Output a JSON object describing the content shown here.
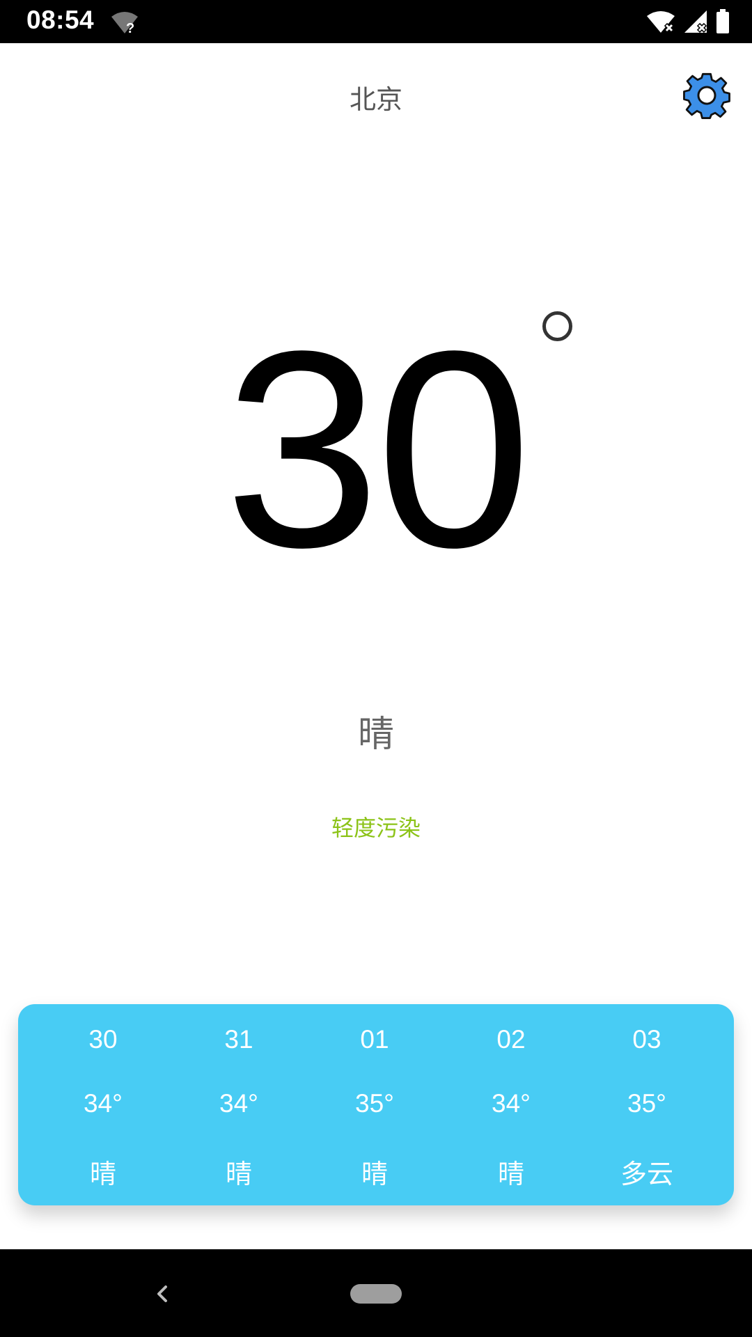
{
  "status_bar": {
    "time": "08:54",
    "icons": [
      "wifi-unknown-icon",
      "wifi-off-icon",
      "signal-off-icon",
      "battery-icon"
    ]
  },
  "header": {
    "city": "北京",
    "settings_icon": "gear-icon"
  },
  "current": {
    "temperature": "30",
    "weather": "晴",
    "air_quality": "轻度污染"
  },
  "forecast": [
    {
      "date": "30",
      "temp": "34°",
      "weather": "晴"
    },
    {
      "date": "31",
      "temp": "34°",
      "weather": "晴"
    },
    {
      "date": "01",
      "temp": "35°",
      "weather": "晴"
    },
    {
      "date": "02",
      "temp": "34°",
      "weather": "晴"
    },
    {
      "date": "03",
      "temp": "35°",
      "weather": "多云"
    }
  ],
  "colors": {
    "forecast_card": "#48ccf4",
    "air_quality_text": "#8cc318",
    "settings_icon": "#3c8fe8"
  },
  "nav_bar": {
    "back_icon": "back-chevron-icon",
    "home_icon": "home-pill-icon"
  }
}
